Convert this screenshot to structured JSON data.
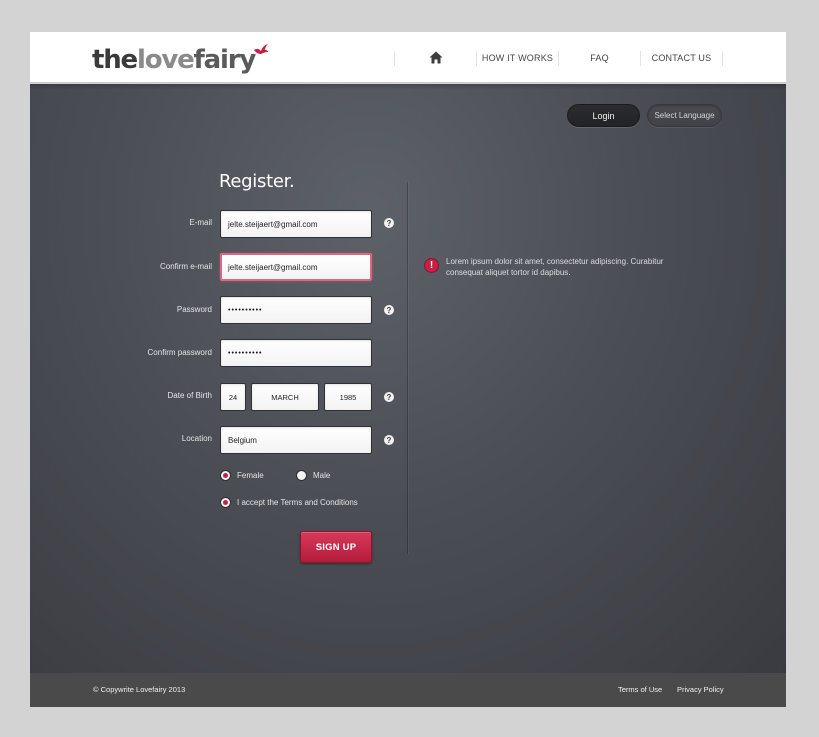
{
  "brand": {
    "logo_the": "the",
    "logo_love": "love",
    "logo_fairy": "fairy",
    "accent_color": "#c81f45"
  },
  "nav": {
    "home_icon": "home-icon",
    "items": [
      {
        "label": "HOW IT WORKS"
      },
      {
        "label": "FAQ"
      },
      {
        "label": "CONTACT US"
      }
    ]
  },
  "topbar": {
    "login_label": "Login",
    "language_label": "Select Language"
  },
  "form": {
    "title": "Register.",
    "email": {
      "label": "E-mail",
      "value": "jelte.steijaert@gmail.com"
    },
    "confirm_email": {
      "label": "Confirm e-mail",
      "value": "jelte.steijaert@gmail.com"
    },
    "password": {
      "label": "Password",
      "value": "••••••••••"
    },
    "confirm_password": {
      "label": "Confirm password",
      "value": "••••••••••"
    },
    "dob": {
      "label": "Date of Birth",
      "day": "24",
      "month": "MARCH",
      "year": "1985"
    },
    "location": {
      "label": "Location",
      "value": "Belgium"
    },
    "help_symbol": "?",
    "gender": {
      "options": [
        {
          "label": "Female",
          "selected": true
        },
        {
          "label": "Male",
          "selected": false
        }
      ]
    },
    "terms": {
      "label": "I accept the Terms and Conditions",
      "checked": true
    },
    "submit_label": "SIGN UP"
  },
  "error": {
    "icon_symbol": "!",
    "message": "Lorem ipsum dolor sit amet, consectetur adipiscing. Curabitur consequat aliquet tortor id dapibus."
  },
  "footer": {
    "copyright": "© Copywrite Lovefairy 2013",
    "links": [
      {
        "label": "Terms of Use"
      },
      {
        "label": "Privacy Policy"
      }
    ]
  }
}
